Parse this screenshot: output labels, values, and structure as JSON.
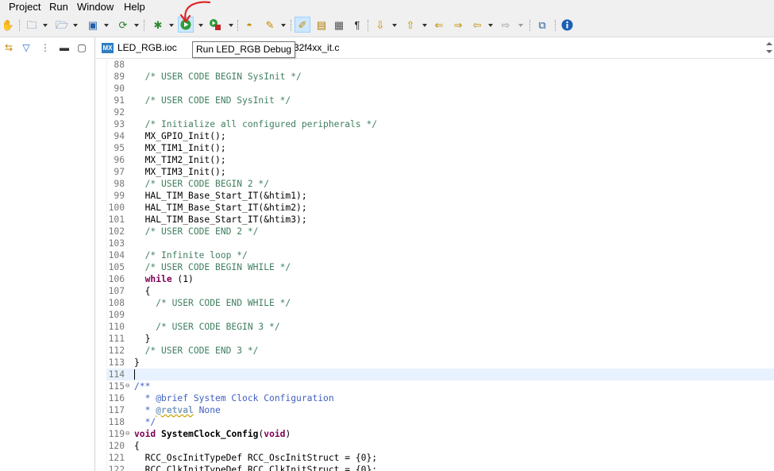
{
  "menu": [
    "Project",
    "Run",
    "Window",
    "Help"
  ],
  "toolbar": {
    "run_tooltip": "Run LED_RGB Debug"
  },
  "editor": {
    "tabs": [
      {
        "icon": "MX",
        "label": "LED_RGB.ioc"
      },
      {
        "label": "m32f4xx_it.c"
      }
    ],
    "lines": [
      {
        "n": "88",
        "t": ""
      },
      {
        "n": "89",
        "t": "  /* USER CODE BEGIN SysInit */"
      },
      {
        "n": "90",
        "t": ""
      },
      {
        "n": "91",
        "t": "  /* USER CODE END SysInit */"
      },
      {
        "n": "92",
        "t": ""
      },
      {
        "n": "93",
        "t": "  /* Initialize all configured peripherals */"
      },
      {
        "n": "94",
        "t": "  MX_GPIO_Init();"
      },
      {
        "n": "95",
        "t": "  MX_TIM1_Init();"
      },
      {
        "n": "96",
        "t": "  MX_TIM2_Init();"
      },
      {
        "n": "97",
        "t": "  MX_TIM3_Init();"
      },
      {
        "n": "98",
        "t": "  /* USER CODE BEGIN 2 */"
      },
      {
        "n": "99",
        "t": "  HAL_TIM_Base_Start_IT(&htim1);"
      },
      {
        "n": "100",
        "t": "  HAL_TIM_Base_Start_IT(&htim2);"
      },
      {
        "n": "101",
        "t": "  HAL_TIM_Base_Start_IT(&htim3);"
      },
      {
        "n": "102",
        "t": "  /* USER CODE END 2 */"
      },
      {
        "n": "103",
        "t": ""
      },
      {
        "n": "104",
        "t": "  /* Infinite loop */"
      },
      {
        "n": "105",
        "t": "  /* USER CODE BEGIN WHILE */"
      },
      {
        "n": "106",
        "kw": "while",
        "t": " (1)",
        "indent": "  "
      },
      {
        "n": "107",
        "t": "  {"
      },
      {
        "n": "108",
        "t": "    /* USER CODE END WHILE */"
      },
      {
        "n": "109",
        "t": ""
      },
      {
        "n": "110",
        "t": "    /* USER CODE BEGIN 3 */"
      },
      {
        "n": "111",
        "t": "  }"
      },
      {
        "n": "112",
        "t": "  /* USER CODE END 3 */"
      },
      {
        "n": "113",
        "t": "}"
      },
      {
        "n": "114",
        "t": ""
      },
      {
        "n": "115",
        "t": "/**"
      },
      {
        "n": "116",
        "t": "  * @brief System Clock Configuration"
      },
      {
        "n": "117",
        "tag": "@retval",
        "t": " None",
        "indent": "  * "
      },
      {
        "n": "118",
        "t": "  */"
      },
      {
        "n": "119",
        "kw": "void",
        "fn": "SystemClock_Config",
        "t": "(",
        "kw2": "void",
        "t2": ")"
      },
      {
        "n": "120",
        "t": "{"
      },
      {
        "n": "121",
        "t": "  RCC_OscInitTypeDef RCC_OscInitStruct = {0};"
      },
      {
        "n": "122",
        "t": "  RCC_ClkInitTypeDef RCC_ClkInitStruct = {0};"
      }
    ]
  },
  "colors": {
    "comment": "#3f7f5f",
    "keyword": "#7f0055",
    "javadoc": "#3f5fbf",
    "current_line": "#e8f2fe",
    "annotation": "#e02020"
  }
}
